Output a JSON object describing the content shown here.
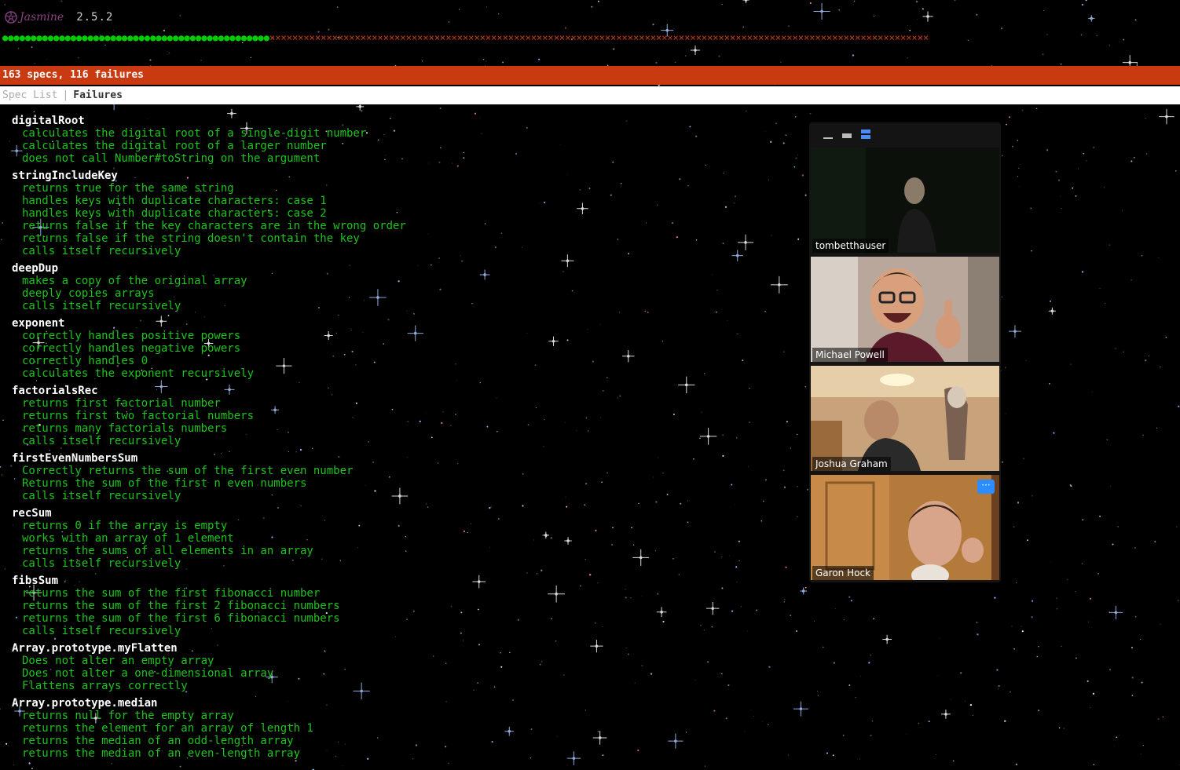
{
  "banner": {
    "logo_text": "Jasmine",
    "version": "2.5.2"
  },
  "symbol_summary": {
    "passed_count": 47,
    "failed_count": 116,
    "layout_sequence": "P47F116"
  },
  "summary": {
    "text": "163 specs, 116 failures"
  },
  "menu": {
    "spec_list": "Spec List",
    "separator": "|",
    "failures": "Failures"
  },
  "suites": [
    {
      "name": "digitalRoot",
      "specs": [
        "calculates the digital root of a single-digit number",
        "calculates the digital root of a larger number",
        "does not call Number#toString on the argument"
      ]
    },
    {
      "name": "stringIncludeKey",
      "specs": [
        "returns true for the same string",
        "handles keys with duplicate characters: case 1",
        "handles keys with duplicate characters: case 2",
        "returns false if the key characters are in the wrong order",
        "returns false if the string doesn't contain the key",
        "calls itself recursively"
      ]
    },
    {
      "name": "deepDup",
      "specs": [
        "makes a copy of the original array",
        "deeply copies arrays",
        "calls itself recursively"
      ]
    },
    {
      "name": "exponent",
      "specs": [
        "correctly handles positive powers",
        "correctly handles negative powers",
        "correctly handles 0",
        "calculates the exponent recursively"
      ]
    },
    {
      "name": "factorialsRec",
      "specs": [
        "returns first factorial number",
        "returns first two factorial numbers",
        "returns many factorials numbers",
        "calls itself recursively"
      ]
    },
    {
      "name": "firstEvenNumbersSum",
      "specs": [
        "Correctly returns the sum of the first even number",
        "Returns the sum of the first n even numbers",
        "calls itself recursively"
      ]
    },
    {
      "name": "recSum",
      "specs": [
        "returns 0 if the array is empty",
        "works with an array of 1 element",
        "returns the sums of all elements in an array",
        "calls itself recursively"
      ]
    },
    {
      "name": "fibsSum",
      "specs": [
        "returns the sum of the first fibonacci number",
        "returns the sum of the first 2 fibonacci numbers",
        "returns the sum of the first 6 fibonacci numbers",
        "calls itself recursively"
      ]
    },
    {
      "name": "Array.prototype.myFlatten",
      "specs": [
        "Does not alter an empty array",
        "Does not alter a one-dimensional array",
        "Flattens arrays correctly"
      ]
    },
    {
      "name": "Array.prototype.median",
      "specs": [
        "returns null for the empty array",
        "returns the element for an array of length 1",
        "returns the median of an odd-length array",
        "returns the median of an even-length array"
      ]
    }
  ],
  "video_panel": {
    "toolbar_icons": [
      "minimize-icon",
      "thumbnail-view-icon",
      "gallery-view-icon"
    ],
    "participants": [
      {
        "name": "tombetthauser",
        "active": false,
        "has_more": false
      },
      {
        "name": "Michael Powell",
        "active": false,
        "has_more": false
      },
      {
        "name": "Joshua Graham",
        "active": true,
        "has_more": false
      },
      {
        "name": "Garon Hock",
        "active": false,
        "has_more": true
      }
    ],
    "more_label": "···"
  },
  "colors": {
    "failure_bar": "#ca3a11",
    "pass_text": "#1ec31e",
    "active_speaker": "#e6f07a",
    "more_button": "#2d8cff"
  }
}
